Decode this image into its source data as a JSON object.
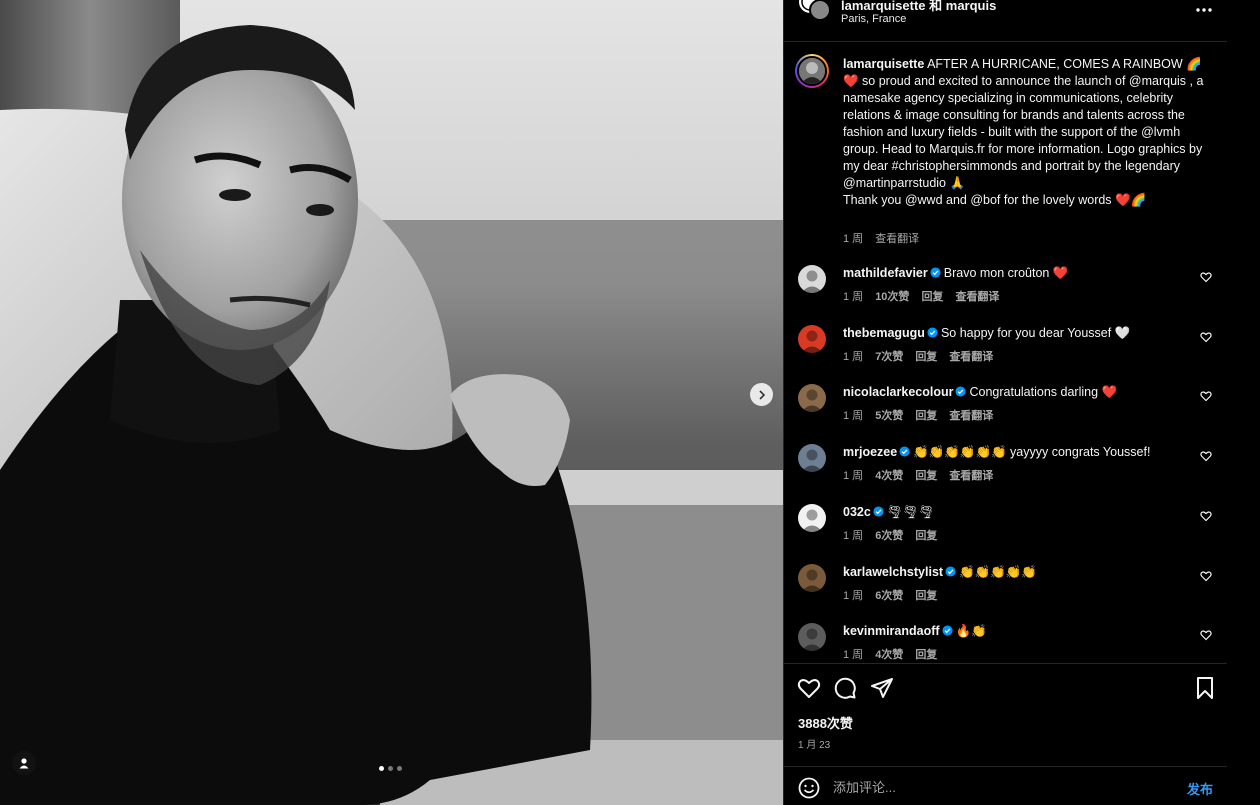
{
  "header": {
    "usernames": "lamarquisette 和 marquis",
    "location": "Paris, France"
  },
  "caption": {
    "username": "lamarquisette",
    "text": "AFTER A HURRICANE, COMES A RAINBOW 🌈❤️ so proud and excited to announce the launch of @marquis , a namesake agency specializing in communications, celebrity relations & image consulting for brands and talents across the fashion and luxury fields - built with the support of the @lvmh group. Head to Marquis.fr for more information. Logo graphics by my dear #christophersimmonds and portrait by the legendary @martinparrstudio 🙏",
    "thanks": "Thank you @wwd and @bof for the lovely words ❤️🌈",
    "time": "1 周",
    "translate": "查看翻译"
  },
  "comments": [
    {
      "username": "mathildefavier",
      "text": "Bravo mon croûton ❤️",
      "time": "1 周",
      "likes": "10次赞",
      "reply": "回复",
      "translate": "查看翻译",
      "avatar_color": "#d9d9d9"
    },
    {
      "username": "thebemagugu",
      "text": "So happy for you dear Youssef 🤍",
      "time": "1 周",
      "likes": "7次赞",
      "reply": "回复",
      "translate": "查看翻译",
      "avatar_color": "#d83a23"
    },
    {
      "username": "nicolaclarkecolour",
      "text": "Congratulations darling ❤️",
      "time": "1 周",
      "likes": "5次赞",
      "reply": "回复",
      "translate": "查看翻译",
      "avatar_color": "#8a6a4a"
    },
    {
      "username": "mrjoezee",
      "text": "👏👏👏👏👏👏 yayyyy congrats Youssef!",
      "time": "1 周",
      "likes": "4次赞",
      "reply": "回复",
      "translate": "查看翻译",
      "avatar_color": "#6f7f93"
    },
    {
      "username": "032c",
      "text": "🌪🌪🌪",
      "time": "1 周",
      "likes": "6次赞",
      "reply": "回复",
      "translate": "",
      "avatar_color": "#f2f2f2"
    },
    {
      "username": "karlawelchstylist",
      "text": "👏👏👏👏👏",
      "time": "1 周",
      "likes": "6次赞",
      "reply": "回复",
      "translate": "",
      "avatar_color": "#7a5a3a"
    },
    {
      "username": "kevinmirandaoff",
      "text": "🔥👏",
      "time": "1 周",
      "likes": "4次赞",
      "reply": "回复",
      "translate": "",
      "avatar_color": "#5c5c5c"
    }
  ],
  "actions": {
    "likes_count": "3888次赞",
    "date": "1 月 23"
  },
  "composer": {
    "placeholder": "添加评论...",
    "post_label": "发布"
  },
  "carousel": {
    "dot_count": 3,
    "active_index": 0
  }
}
